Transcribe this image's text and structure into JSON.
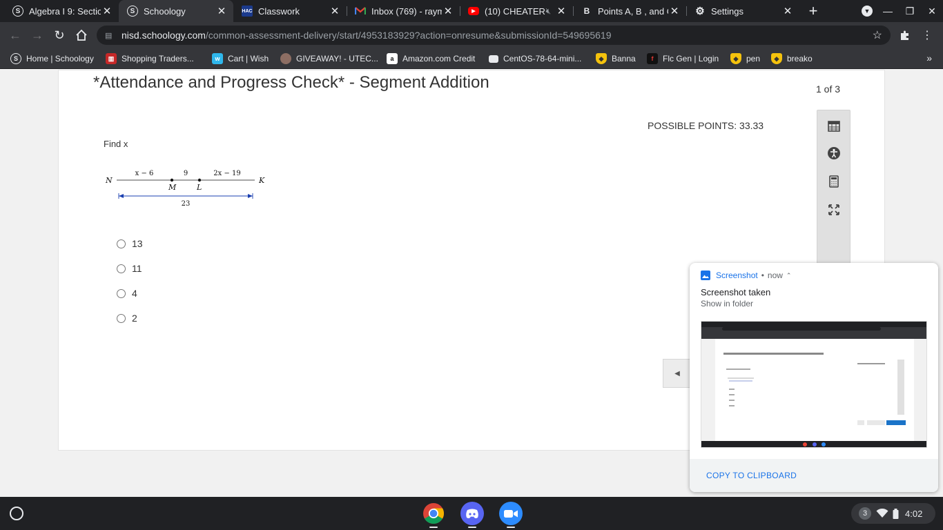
{
  "browser": {
    "tabs": [
      {
        "title": "Algebra I 9: Sectio",
        "favicon": "schoology-icon",
        "active": false
      },
      {
        "title": "Schoology",
        "favicon": "schoology-icon",
        "active": true
      },
      {
        "title": "Classwork",
        "favicon": "hac-icon",
        "favicon_text": "HAC",
        "active": false
      },
      {
        "title": "Inbox (769) - raym",
        "favicon": "gmail-icon",
        "active": false
      },
      {
        "title": "(10) CHEATER",
        "favicon": "youtube-icon",
        "active": false,
        "audio": "speaker-icon"
      },
      {
        "title": "Points A, B , and C",
        "favicon": "brainly-icon",
        "favicon_text": "B",
        "active": false
      },
      {
        "title": "Settings",
        "favicon": "gear-icon",
        "active": false
      }
    ],
    "new_tab_icon": "plus-icon",
    "url": {
      "host": "nisd.schoology.com",
      "path": "/common-assessment-delivery/start/4953183929?action=onresume&submissionId=549695619"
    },
    "bookmarks": [
      {
        "label": "Home | Schoology",
        "icon": "schoology-icon"
      },
      {
        "label": "Shopping Traders...",
        "icon": "store-icon"
      },
      {
        "label": "Cart | Wish",
        "icon": "wish-icon"
      },
      {
        "label": "GIVEAWAY! - UTEC...",
        "icon": "avatar-icon"
      },
      {
        "label": "Amazon.com Credit",
        "icon": "amazon-icon"
      },
      {
        "label": "CentOS-78-64-mini...",
        "icon": "file-icon"
      },
      {
        "label": "Banna",
        "icon": "shield-icon"
      },
      {
        "label": "Flc Gen | Login",
        "icon": "flc-icon"
      },
      {
        "label": "pen",
        "icon": "shield-icon"
      },
      {
        "label": "breako",
        "icon": "shield-icon"
      }
    ]
  },
  "assessment": {
    "title": "*Attendance and Progress Check* - Segment Addition",
    "page_count": "1 of 3",
    "possible_points": "POSSIBLE POINTS: 33.33",
    "prompt": "Find x",
    "figure": {
      "left_point": "N",
      "right_point": "K",
      "point_m": "M",
      "point_l": "L",
      "seg_nm": "x − 6",
      "seg_ml": "9",
      "seg_lk": "2x − 19",
      "total": "23"
    },
    "choices": [
      "13",
      "11",
      "4",
      "2"
    ]
  },
  "notification": {
    "app": "Screenshot",
    "dot": "•",
    "time": "now",
    "title": "Screenshot taken",
    "subtitle": "Show in folder",
    "action": "COPY TO CLIPBOARD"
  },
  "shelf": {
    "apps": [
      "chrome-icon",
      "discord-icon",
      "zoom-icon"
    ],
    "notification_count": "3",
    "time": "4:02"
  }
}
